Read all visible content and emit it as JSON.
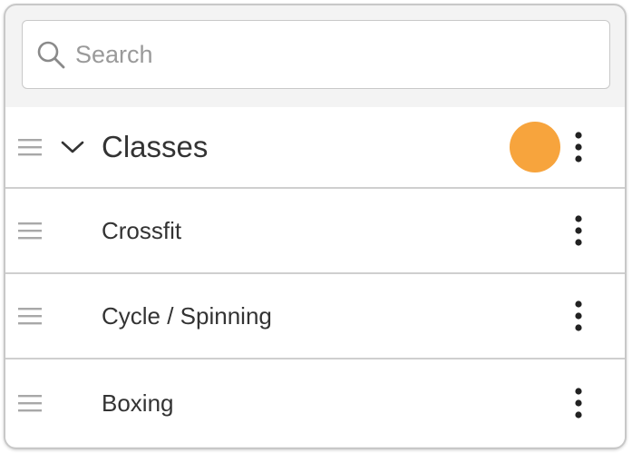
{
  "search": {
    "placeholder": "Search",
    "value": ""
  },
  "group": {
    "label": "Classes",
    "status_color": "#f7a43d",
    "icons": {
      "drag": "drag-handle-icon",
      "toggle": "chevron-down-icon",
      "menu": "more-vertical-icon"
    }
  },
  "items": [
    {
      "label": "Crossfit"
    },
    {
      "label": "Cycle / Spinning"
    },
    {
      "label": "Boxing"
    }
  ],
  "colors": {
    "border": "#cfcfcf",
    "panel_bg": "#f3f3f3",
    "text": "#333333"
  }
}
